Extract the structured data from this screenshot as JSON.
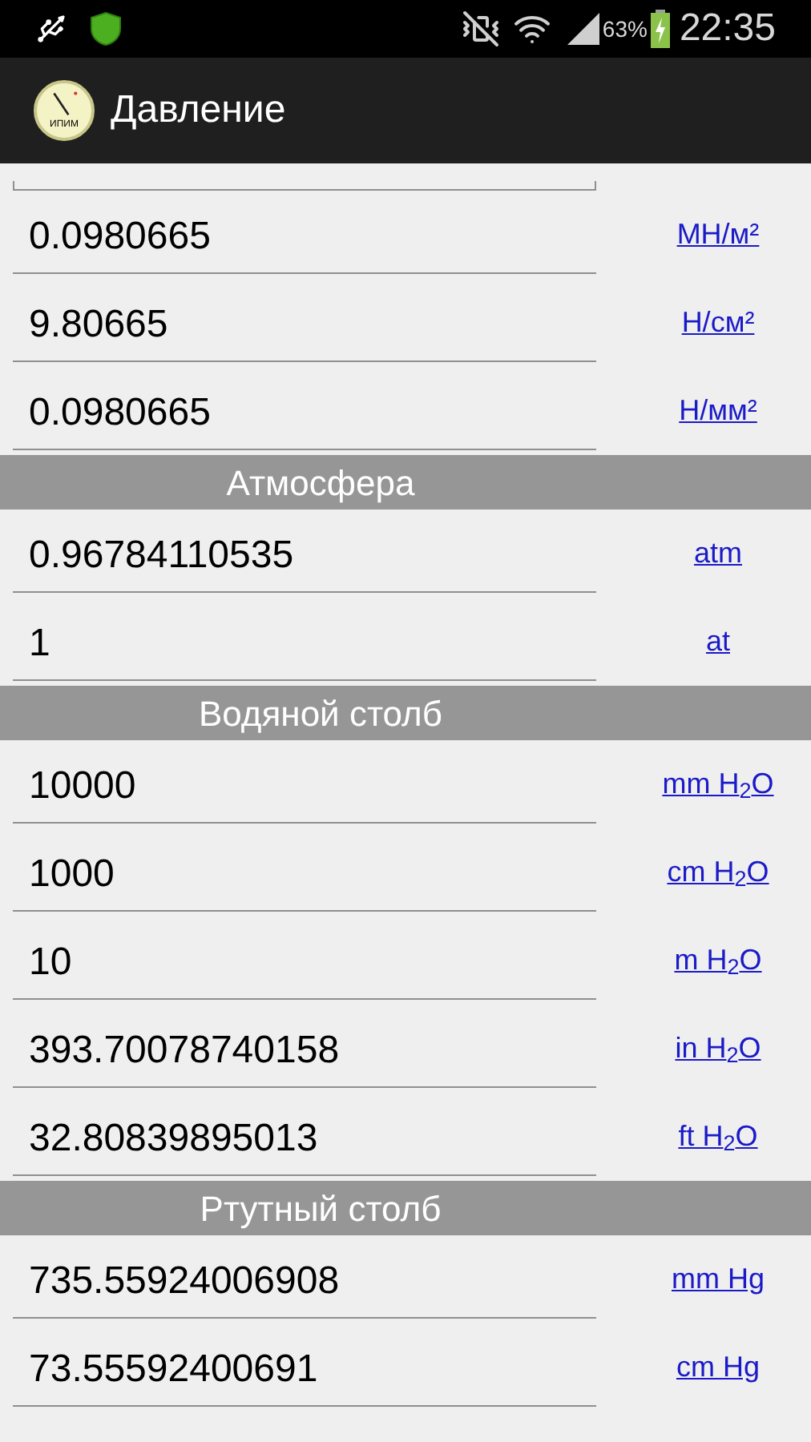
{
  "status_bar": {
    "battery": "63%",
    "time": "22:35"
  },
  "app_bar": {
    "icon_label": "ИПИМ",
    "title": "Давление"
  },
  "rows": [
    {
      "kind": "cut"
    },
    {
      "kind": "field",
      "value": "0.0980665",
      "unit": "МН/м²"
    },
    {
      "kind": "field",
      "value": "9.80665",
      "unit": "Н/см²"
    },
    {
      "kind": "field",
      "value": "0.0980665",
      "unit": "Н/мм²"
    },
    {
      "kind": "header",
      "title": "Атмосфера"
    },
    {
      "kind": "field",
      "value": "0.96784110535",
      "unit": "atm"
    },
    {
      "kind": "field",
      "value": "1",
      "unit": "at"
    },
    {
      "kind": "header",
      "title": "Водяной столб"
    },
    {
      "kind": "field",
      "value": "10000",
      "unit": "mm H$_{2}$O"
    },
    {
      "kind": "field",
      "value": "1000",
      "unit": "cm H$_{2}$O"
    },
    {
      "kind": "field",
      "value": "10",
      "unit": "m H$_{2}$O"
    },
    {
      "kind": "field",
      "value": "393.70078740158",
      "unit": "in H$_{2}$O"
    },
    {
      "kind": "field",
      "value": "32.80839895013",
      "unit": "ft H$_{2}$O"
    },
    {
      "kind": "header",
      "title": "Ртутный столб"
    },
    {
      "kind": "field",
      "value": "735.55924006908",
      "unit": "mm Hg"
    },
    {
      "kind": "field",
      "value": "73.55592400691",
      "unit": "cm Hg"
    }
  ]
}
